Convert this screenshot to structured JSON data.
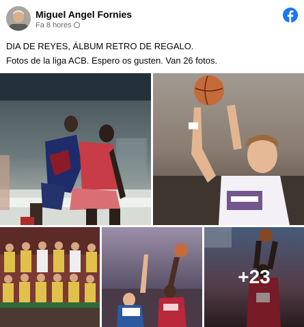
{
  "post": {
    "author": "Miguel Angel Fornies",
    "time": "Fa 8 hores",
    "text_line1": "DIA DE REYES, ÁLBUM RETRO DE REGALO.",
    "text_line2": "Fotos de la liga ACB. Espero os gusten. Van 26 fotos.",
    "brand_icon": "facebook-icon",
    "audience_icon": "globe-icon",
    "accent": "#1877f2"
  },
  "photos": {
    "more_count": "+23",
    "items": [
      {
        "subject": "photo-1-players-red-blue"
      },
      {
        "subject": "photo-2-player-shooting"
      },
      {
        "subject": "photo-3-team-portrait"
      },
      {
        "subject": "photo-4-jump-ball"
      },
      {
        "subject": "photo-5-player-red-jersey"
      }
    ]
  }
}
